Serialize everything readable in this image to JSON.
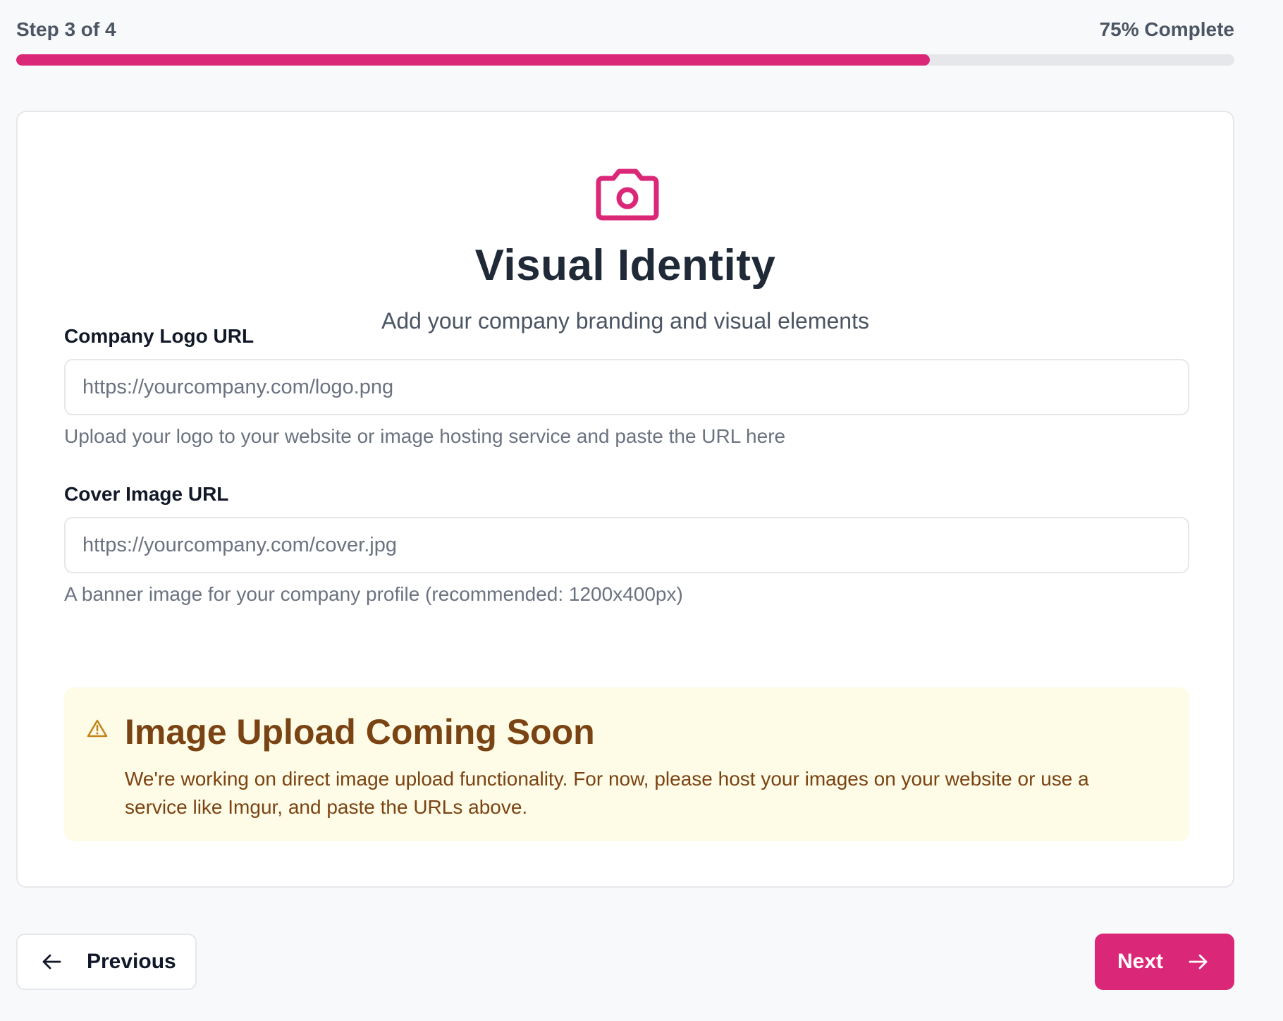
{
  "progress": {
    "step_text": "Step 3 of 4",
    "percent_text": "75% Complete",
    "fraction": 0.75,
    "color": "#db2777"
  },
  "card": {
    "icon": "camera-icon",
    "title": "Visual Identity",
    "subtitle": "Add your company branding and visual elements"
  },
  "fields": {
    "logo": {
      "label": "Company Logo URL",
      "placeholder": "https://yourcompany.com/logo.png",
      "value": "",
      "help": "Upload your logo to your website or image hosting service and paste the URL here"
    },
    "cover": {
      "label": "Cover Image URL",
      "placeholder": "https://yourcompany.com/cover.jpg",
      "value": "",
      "help": "A banner image for your company profile (recommended: 1200x400px)"
    }
  },
  "alert": {
    "icon": "warning-icon",
    "title": "Image Upload Coming Soon",
    "body": "We're working on direct image upload functionality. For now, please host your images on your website or use a service like Imgur, and paste the URLs above."
  },
  "nav": {
    "previous_label": "Previous",
    "next_label": "Next"
  },
  "colors": {
    "accent": "#db2777",
    "warning_text": "#7a4313",
    "warning_bg": "#fefbe6"
  }
}
